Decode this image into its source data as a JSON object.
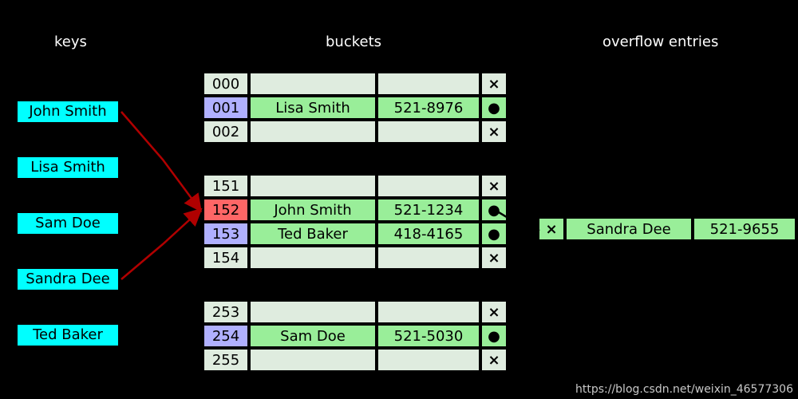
{
  "headings": {
    "keys": "keys",
    "buckets": "buckets",
    "overflow": "overflow entries"
  },
  "keys": [
    {
      "label": "John Smith"
    },
    {
      "label": "Lisa Smith"
    },
    {
      "label": "Sam Doe"
    },
    {
      "label": "Sandra Dee"
    },
    {
      "label": "Ted Baker"
    }
  ],
  "bucket_groups": [
    {
      "rows": [
        {
          "idx": "000",
          "name": "",
          "val": "",
          "end": "×",
          "filled": false,
          "idx_hl": ""
        },
        {
          "idx": "001",
          "name": "Lisa Smith",
          "val": "521-8976",
          "end": "●",
          "filled": true,
          "idx_hl": "blue"
        },
        {
          "idx": "002",
          "name": "",
          "val": "",
          "end": "×",
          "filled": false,
          "idx_hl": ""
        }
      ]
    },
    {
      "rows": [
        {
          "idx": "151",
          "name": "",
          "val": "",
          "end": "×",
          "filled": false,
          "idx_hl": ""
        },
        {
          "idx": "152",
          "name": "John Smith",
          "val": "521-1234",
          "end": "●",
          "filled": true,
          "idx_hl": "red"
        },
        {
          "idx": "153",
          "name": "Ted Baker",
          "val": "418-4165",
          "end": "●",
          "filled": true,
          "idx_hl": "blue"
        },
        {
          "idx": "154",
          "name": "",
          "val": "",
          "end": "×",
          "filled": false,
          "idx_hl": ""
        }
      ]
    },
    {
      "rows": [
        {
          "idx": "253",
          "name": "",
          "val": "",
          "end": "×",
          "filled": false,
          "idx_hl": ""
        },
        {
          "idx": "254",
          "name": "Sam Doe",
          "val": "521-5030",
          "end": "●",
          "filled": true,
          "idx_hl": "blue"
        },
        {
          "idx": "255",
          "name": "",
          "val": "",
          "end": "×",
          "filled": false,
          "idx_hl": ""
        }
      ]
    }
  ],
  "overflow": {
    "end": "×",
    "name": "Sandra Dee",
    "val": "521-9655"
  },
  "watermark": "https://blog.csdn.net/weixin_46577306"
}
